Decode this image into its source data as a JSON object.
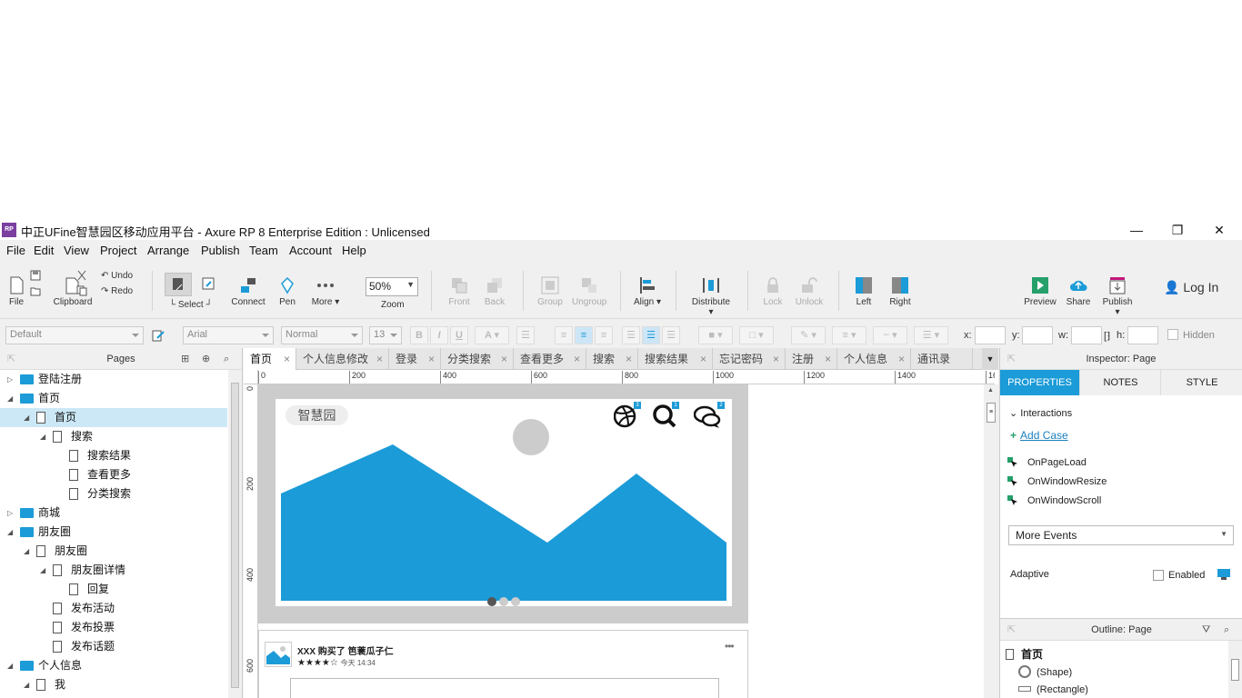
{
  "window": {
    "title": "中正UFine智慧园区移动应用平台 - Axure RP 8 Enterprise Edition : Unlicensed",
    "app_icon": "RP",
    "controls": [
      "—",
      "❐",
      "✕"
    ]
  },
  "menu": [
    "File",
    "Edit",
    "View",
    "Project",
    "Arrange",
    "Publish",
    "Team",
    "Account",
    "Help"
  ],
  "toolbar": {
    "file_label": "File",
    "clipboard_label": "Clipboard",
    "undo_label": "Undo",
    "redo_label": "Redo",
    "select_label": "Select",
    "connect_label": "Connect",
    "pen_label": "Pen",
    "more_label": "More ▾",
    "zoom_value": "50%",
    "zoom_label": "Zoom",
    "front_label": "Front",
    "back_label": "Back",
    "group_label": "Group",
    "ungroup_label": "Ungroup",
    "align_label": "Align ▾",
    "distribute_label": "Distribute ▾",
    "lock_label": "Lock",
    "unlock_label": "Unlock",
    "left_label": "Left",
    "right_label": "Right",
    "preview_label": "Preview",
    "share_label": "Share",
    "publish_label": "Publish ▾",
    "login_label": "Log In"
  },
  "format": {
    "style": "Default",
    "font": "Arial",
    "weight": "Normal",
    "size": "13",
    "x_label": "x:",
    "y_label": "y:",
    "w_label": "w:",
    "h_label": "h:",
    "hidden_label": "Hidden"
  },
  "pages": {
    "header": "Pages",
    "items": [
      {
        "label": "登陆注册",
        "kind": "folder",
        "twisty": "▷"
      },
      {
        "label": "首页",
        "kind": "folder",
        "twisty": "◢"
      },
      {
        "label": "首页",
        "kind": "page",
        "twisty": "◢",
        "selected": true
      },
      {
        "label": "搜索",
        "kind": "page",
        "twisty": "◢"
      },
      {
        "label": "搜索结果",
        "kind": "page",
        "twisty": ""
      },
      {
        "label": "查看更多",
        "kind": "page",
        "twisty": ""
      },
      {
        "label": "分类搜索",
        "kind": "page",
        "twisty": ""
      },
      {
        "label": "商城",
        "kind": "folder",
        "twisty": "▷"
      },
      {
        "label": "朋友圈",
        "kind": "folder",
        "twisty": "◢"
      },
      {
        "label": "朋友圈",
        "kind": "page",
        "twisty": "◢"
      },
      {
        "label": "朋友圈详情",
        "kind": "page",
        "twisty": "◢"
      },
      {
        "label": "回复",
        "kind": "page",
        "twisty": ""
      },
      {
        "label": "发布活动",
        "kind": "page",
        "twisty": ""
      },
      {
        "label": "发布投票",
        "kind": "page",
        "twisty": ""
      },
      {
        "label": "发布话题",
        "kind": "page",
        "twisty": ""
      },
      {
        "label": "个人信息",
        "kind": "folder",
        "twisty": "◢"
      },
      {
        "label": "我",
        "kind": "page",
        "twisty": "◢"
      }
    ]
  },
  "tabs": [
    "首页",
    "个人信息修改",
    "登录",
    "分类搜索",
    "查看更多",
    "搜索",
    "搜索结果",
    "忘记密码",
    "注册",
    "个人信息",
    "通讯录"
  ],
  "ruler": {
    "h": [
      "0",
      "200",
      "400",
      "600",
      "800",
      "1000",
      "1200",
      "1400",
      "16"
    ],
    "v": [
      "0",
      "200",
      "400",
      "600"
    ]
  },
  "canvas": {
    "logo_text": "智慧园",
    "badge_1": "3",
    "badge_2": "1",
    "badge_3": "2",
    "feed_title": "XXX 购买了 ",
    "feed_item": "笆蓑瓜子仁",
    "feed_stars": "★★★★☆",
    "feed_time": "今天 14:34",
    "more_dots": "•••",
    "accent": "#1b9bd7"
  },
  "inspector": {
    "header": "Inspector: Page",
    "tabs": [
      "PROPERTIES",
      "NOTES",
      "STYLE"
    ],
    "interactions_label": "Interactions",
    "add_case_label": "Add Case",
    "events": [
      "OnPageLoad",
      "OnWindowResize",
      "OnWindowScroll"
    ],
    "more_events_label": "More Events",
    "adaptive_label": "Adaptive",
    "enabled_label": "Enabled"
  },
  "outline": {
    "header": "Outline: Page",
    "root": "首页",
    "items": [
      "(Shape)",
      "(Rectangle)"
    ]
  }
}
